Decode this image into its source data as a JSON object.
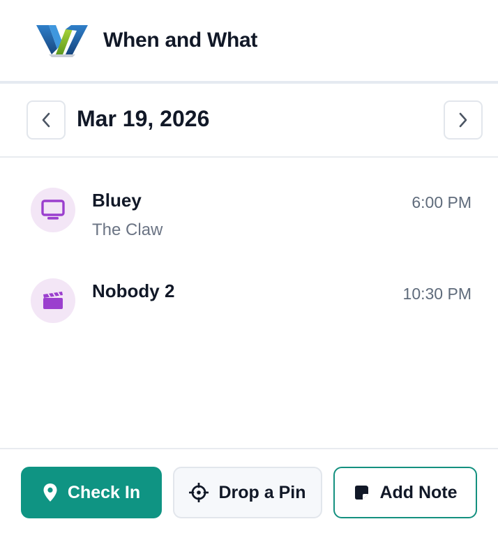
{
  "header": {
    "app_title": "When and What",
    "logo": "when-and-what-logo"
  },
  "datebar": {
    "date": "Mar 19, 2026",
    "prev_icon": "chevron-left-icon",
    "next_icon": "chevron-right-icon"
  },
  "entries": [
    {
      "icon": "tv-icon",
      "title": "Bluey",
      "subtitle": "The Claw",
      "time": "6:00 PM"
    },
    {
      "icon": "clapperboard-icon",
      "title": "Nobody 2",
      "subtitle": "",
      "time": "10:30 PM"
    }
  ],
  "actions": {
    "check_in": "Check In",
    "drop_pin": "Drop a Pin",
    "add_note": "Add Note"
  },
  "colors": {
    "accent": "#0f9483",
    "icon_purple": "#9b3fce",
    "icon_bg": "#f3e6f6"
  }
}
